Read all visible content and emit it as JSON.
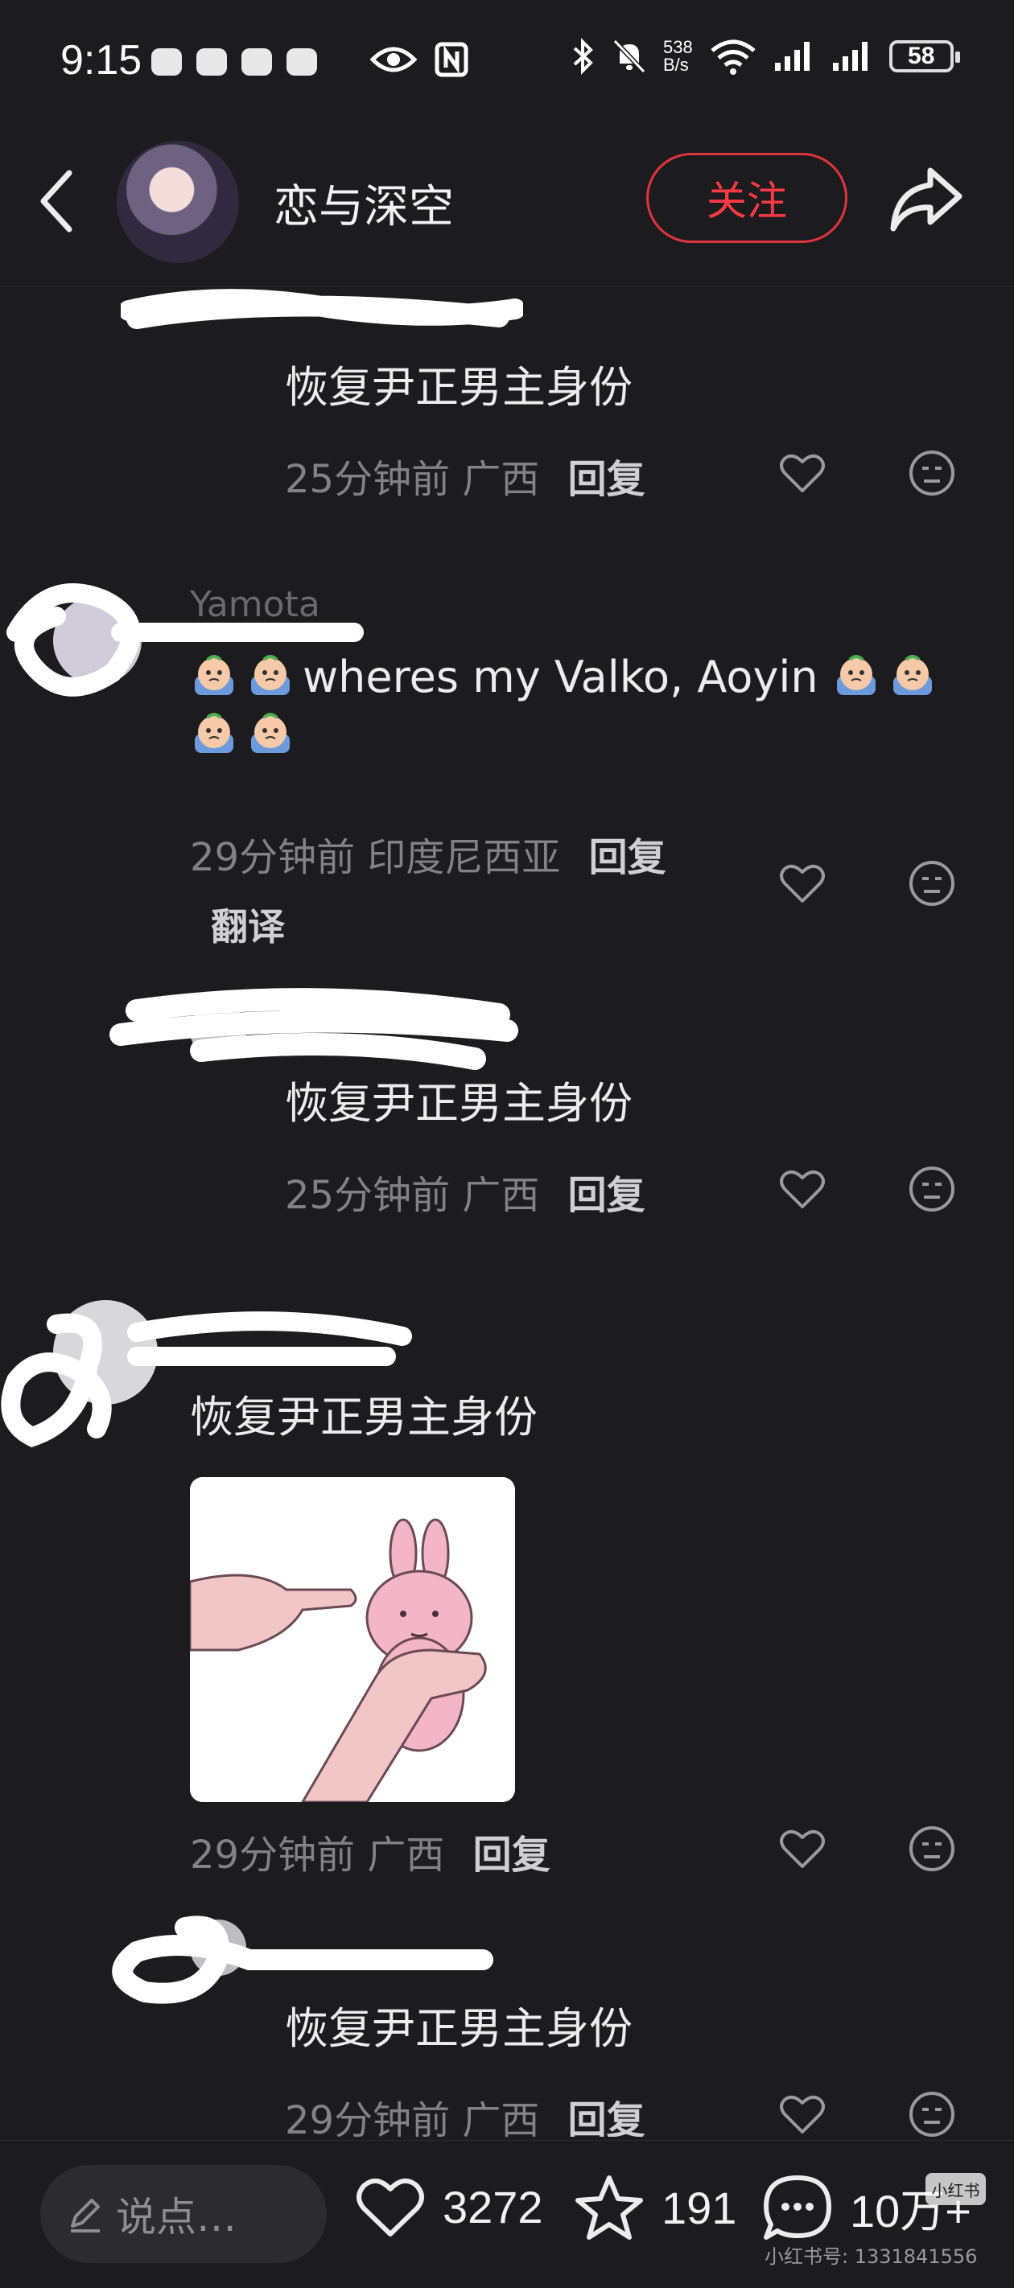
{
  "status_bar": {
    "time": "9:15",
    "network_speed_value": "538",
    "network_speed_unit": "B/s",
    "battery_level": "58"
  },
  "header": {
    "title": "恋与深空",
    "follow_label": "关注"
  },
  "comments": [
    {
      "text": "恢复尹正男主身份",
      "time": "25分钟前",
      "location": "广西",
      "reply_label": "回复"
    },
    {
      "author": "Yamota",
      "text": "wheres my Valko, Aoyin",
      "time": "29分钟前",
      "location": "印度尼西亚",
      "reply_label": "回复",
      "translate_label": "翻译"
    },
    {
      "text": "恢复尹正男主身份",
      "time": "25分钟前",
      "location": "广西",
      "reply_label": "回复"
    },
    {
      "text": "恢复尹正男主身份",
      "time": "29分钟前",
      "location": "广西",
      "reply_label": "回复"
    },
    {
      "text": "恢复尹正男主身份",
      "time": "29分钟前",
      "location": "广西",
      "reply_label": "回复"
    }
  ],
  "bottom_bar": {
    "input_placeholder": "说点…",
    "likes": "3272",
    "favorites": "191",
    "comments_count": "10万+",
    "watermark_text": "小红书号: 1331841556",
    "watermark_logo": "小红书"
  },
  "colors": {
    "background": "#1c1c1e",
    "accent_red": "#ff3a44",
    "meta_gray": "#818186",
    "text_light": "#ececec"
  },
  "icons": [
    "chevron-left-icon",
    "share-arrow-icon",
    "heart-icon",
    "emoji-icon",
    "star-icon",
    "chat-bubble-icon",
    "pencil-icon",
    "bluetooth-icon",
    "mute-bell-icon",
    "wifi-icon",
    "signal-icon",
    "eye-icon",
    "nfc-icon"
  ]
}
